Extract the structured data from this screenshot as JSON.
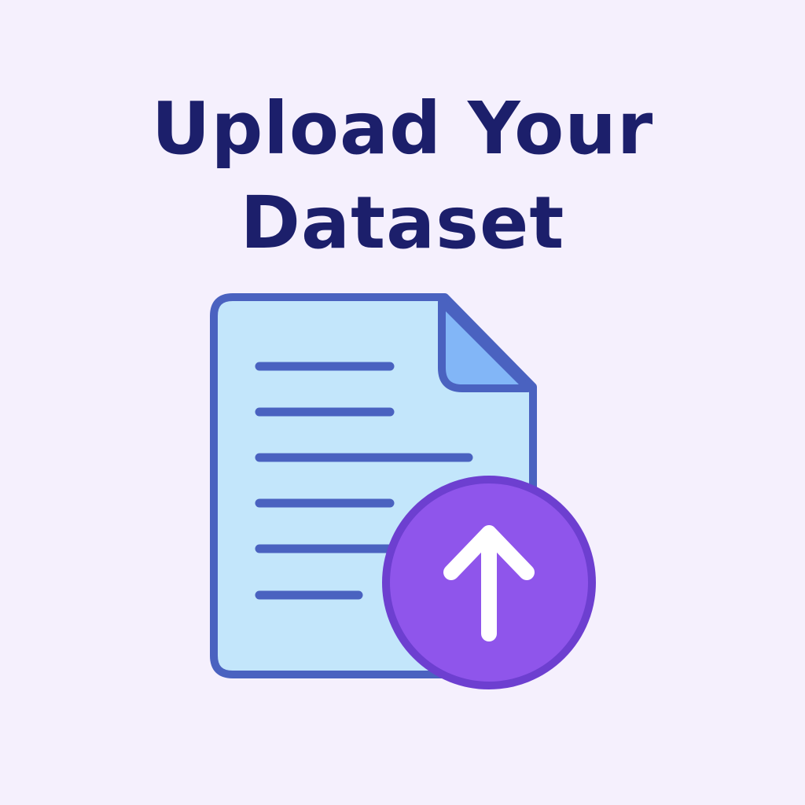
{
  "title": {
    "line1": "Upload Your",
    "line2": "Dataset"
  },
  "icons": {
    "document": "document-icon",
    "upload": "upload-arrow-icon"
  },
  "colors": {
    "background": "#f5f0fd",
    "title": "#1c1f6b",
    "document_fill": "#c3e6fb",
    "document_stroke": "#4a62c0",
    "fold_fill": "#82b6f7",
    "text_lines": "#4a62c0",
    "upload_circle": "#8f55eb",
    "upload_ring": "#6d3fd0",
    "arrow": "#ffffff"
  }
}
